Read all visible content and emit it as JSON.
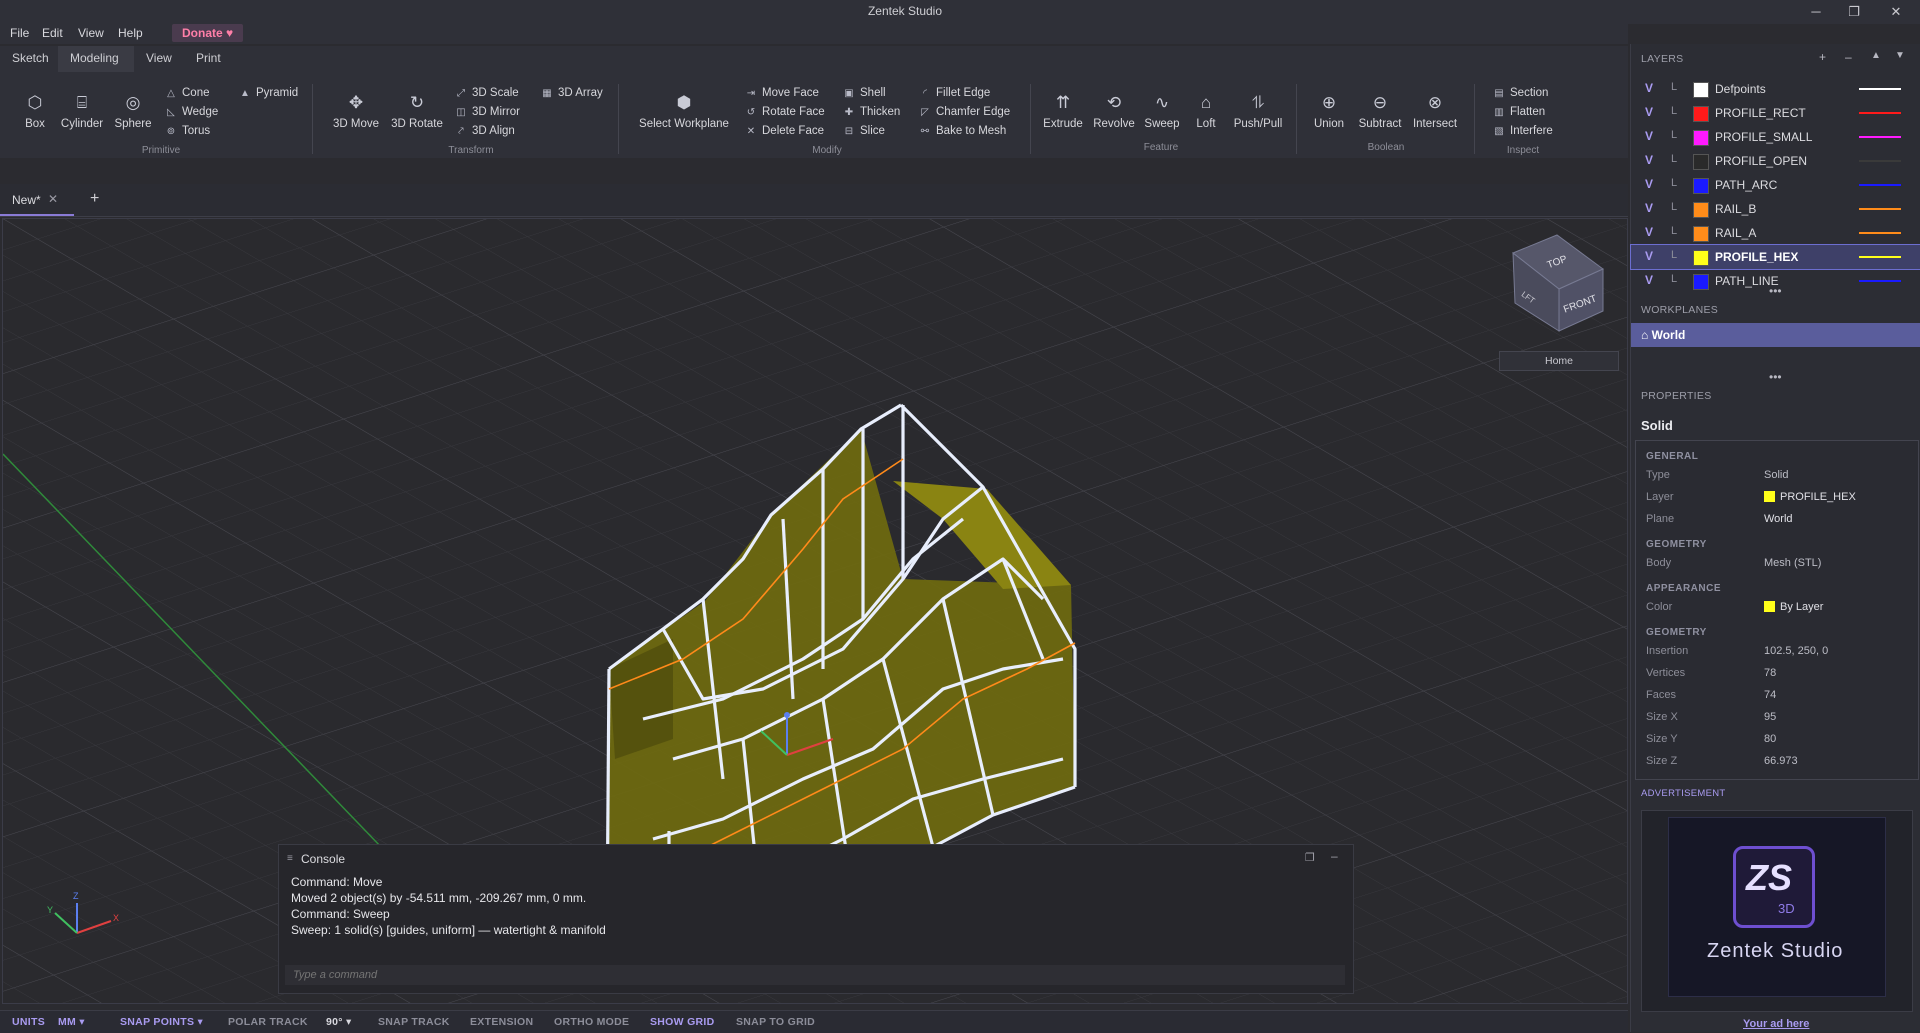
{
  "app": {
    "title": "Zentek Studio"
  },
  "menu": {
    "file": "File",
    "edit": "Edit",
    "view": "View",
    "help": "Help",
    "donate": "Donate ♥"
  },
  "ribbon_tabs": {
    "sketch": "Sketch",
    "modeling": "Modeling",
    "view": "View",
    "print": "Print"
  },
  "primitive": {
    "box": "Box",
    "cylinder": "Cylinder",
    "sphere": "Sphere",
    "cone": "Cone",
    "wedge": "Wedge",
    "torus": "Torus",
    "pyramid": "Pyramid",
    "group": "Primitive"
  },
  "transform": {
    "move": "3D Move",
    "rotate": "3D Rotate",
    "scale": "3D Scale",
    "mirror": "3D Mirror",
    "align": "3D Align",
    "array": "3D Array",
    "group": "Transform"
  },
  "modify": {
    "select_workplane": "Select Workplane",
    "move_face": "Move Face",
    "rotate_face": "Rotate Face",
    "delete_face": "Delete Face",
    "shell": "Shell",
    "thicken": "Thicken",
    "slice": "Slice",
    "fillet_edge": "Fillet Edge",
    "chamfer_edge": "Chamfer Edge",
    "bake_to_mesh": "Bake to Mesh",
    "group": "Modify"
  },
  "feature": {
    "extrude": "Extrude",
    "revolve": "Revolve",
    "sweep": "Sweep",
    "loft": "Loft",
    "push_pull": "Push/Pull",
    "group": "Feature"
  },
  "boolean": {
    "union": "Union",
    "subtract": "Subtract",
    "intersect": "Intersect",
    "group": "Boolean"
  },
  "inspect": {
    "section": "Section",
    "flatten": "Flatten",
    "interfere": "Interfere",
    "group": "Inspect"
  },
  "document": {
    "tab_label": "New*"
  },
  "viewcube": {
    "top": "TOP",
    "front": "FRONT",
    "left": "LFT",
    "home": "Home"
  },
  "console": {
    "title": "Console",
    "lines": [
      "Command: Move",
      "Moved 2 object(s) by -54.511 mm, -209.267 mm, 0 mm.",
      "Command: Sweep",
      "Sweep: 1 solid(s)  [guides, uniform]  — watertight & manifold"
    ],
    "placeholder": "Type a command"
  },
  "statusbar": {
    "units_label": "UNITS",
    "units_value": "MM ▾",
    "snap_points": "SNAP POINTS ▾",
    "polar_track": "POLAR TRACK",
    "angle": "90° ▾",
    "snap_track": "SNAP TRACK",
    "extension": "EXTENSION",
    "ortho": "ORTHO MODE",
    "show_grid": "SHOW GRID",
    "snap_to_grid": "SNAP TO GRID"
  },
  "layers": {
    "title": "LAYERS",
    "rows": [
      {
        "vis": "V",
        "lock": "L",
        "name": "Defpoints",
        "color": "#ffffff"
      },
      {
        "vis": "V",
        "lock": "L",
        "name": "PROFILE_RECT",
        "color": "#ff1a1a"
      },
      {
        "vis": "V",
        "lock": "L",
        "name": "PROFILE_SMALL",
        "color": "#ff1aff"
      },
      {
        "vis": "V",
        "lock": "L",
        "name": "PROFILE_OPEN",
        "color": "#2a2a2a"
      },
      {
        "vis": "V",
        "lock": "L",
        "name": "PATH_ARC",
        "color": "#1a1aff"
      },
      {
        "vis": "V",
        "lock": "L",
        "name": "RAIL_B",
        "color": "#ff8c1a"
      },
      {
        "vis": "V",
        "lock": "L",
        "name": "RAIL_A",
        "color": "#ff8c1a"
      },
      {
        "vis": "V",
        "lock": "L",
        "name": "PROFILE_HEX",
        "color": "#ffff1a"
      },
      {
        "vis": "V",
        "lock": "L",
        "name": "PATH_LINE",
        "color": "#1a1aff"
      }
    ]
  },
  "workplanes": {
    "title": "WORKPLANES",
    "world": "⌂ World"
  },
  "properties": {
    "title": "PROPERTIES",
    "object": "Solid",
    "general_head": "GENERAL",
    "type_k": "Type",
    "type_v": "Solid",
    "layer_k": "Layer",
    "layer_v": "PROFILE_HEX",
    "plane_k": "Plane",
    "plane_v": "World",
    "geometry_head": "GEOMETRY",
    "body_k": "Body",
    "body_v": "Mesh (STL)",
    "appearance_head": "APPEARANCE",
    "color_k": "Color",
    "color_v": "By Layer",
    "geometry2_head": "GEOMETRY",
    "insertion_k": "Insertion",
    "insertion_v": "102.5, 250, 0",
    "vertices_k": "Vertices",
    "vertices_v": "78",
    "faces_k": "Faces",
    "faces_v": "74",
    "sizex_k": "Size X",
    "sizex_v": "95",
    "sizey_k": "Size Y",
    "sizey_v": "80",
    "sizez_k": "Size Z",
    "sizez_v": "66.973"
  },
  "ad": {
    "title": "ADVERTISEMENT",
    "logo_mark": "ZS",
    "logo_sub": "3D",
    "brand": "Zentek Studio",
    "link": "Your ad here"
  },
  "colors": {
    "accent": "#8a7bd6",
    "highlight_yellow": "#ffff1a"
  }
}
